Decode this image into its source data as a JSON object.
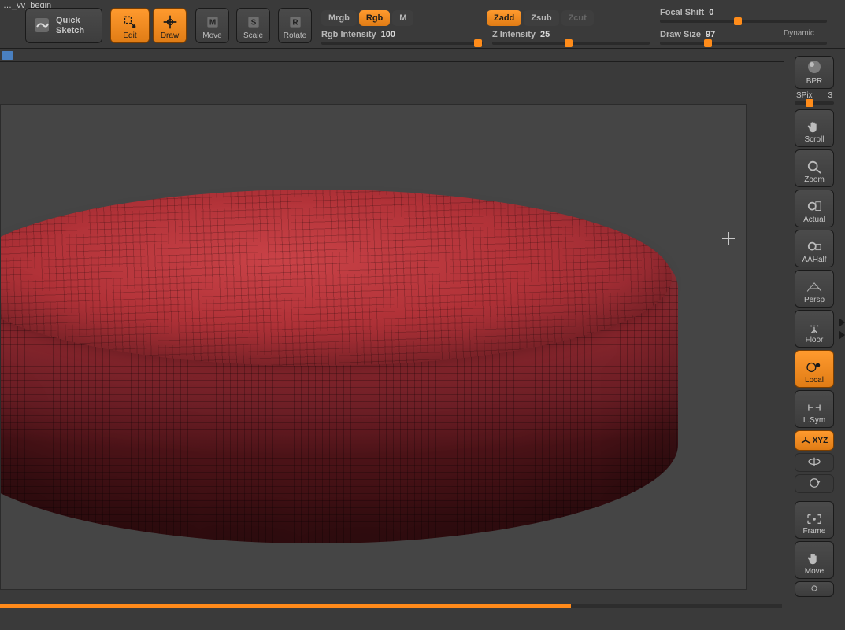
{
  "file_title": "…_vv_begin",
  "toolbar": {
    "quick_sketch_l1": "Quick",
    "quick_sketch_l2": "Sketch",
    "edit": "Edit",
    "draw": "Draw",
    "move": "Move",
    "scale": "Scale",
    "rotate": "Rotate"
  },
  "modes": {
    "mrgb": "Mrgb",
    "rgb": "Rgb",
    "m": "M",
    "zadd": "Zadd",
    "zsub": "Zsub",
    "zcut": "Zcut"
  },
  "sliders": {
    "rgb_intensity_label": "Rgb Intensity",
    "rgb_intensity_value": "100",
    "z_intensity_label": "Z Intensity",
    "z_intensity_value": "25",
    "focal_shift_label": "Focal Shift",
    "focal_shift_value": "0",
    "draw_size_label": "Draw Size",
    "draw_size_value": "97",
    "dynamic": "Dynamic"
  },
  "rail": {
    "bpr": "BPR",
    "spix_l": "SPix",
    "spix_v": "3",
    "scroll": "Scroll",
    "zoom": "Zoom",
    "actual": "Actual",
    "aahalf": "AAHalf",
    "persp": "Persp",
    "floor": "Floor",
    "local": "Local",
    "lsym": "L.Sym",
    "xyz": "XYZ",
    "frame": "Frame",
    "move": "Move"
  },
  "progress_pct": 73
}
